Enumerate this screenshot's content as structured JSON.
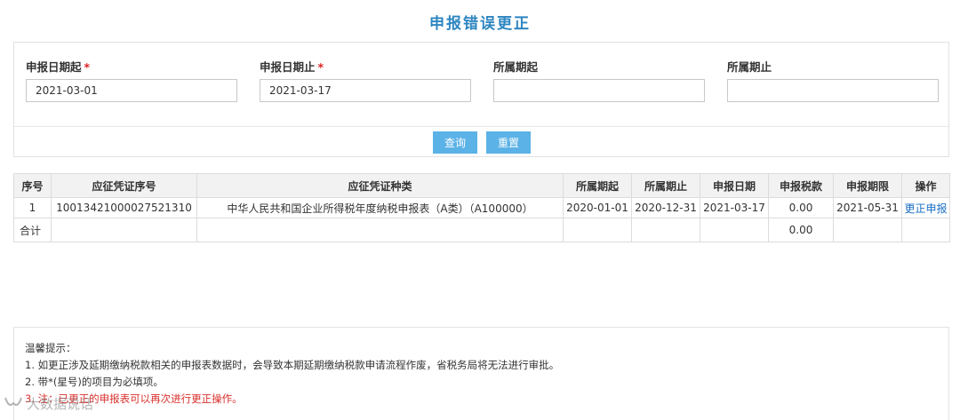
{
  "page": {
    "title": "申报错误更正"
  },
  "filters": {
    "start_date": {
      "label": "申报日期起",
      "required_mark": "*",
      "value": "2021-03-01"
    },
    "end_date": {
      "label": "申报日期止",
      "required_mark": "*",
      "value": "2021-03-17"
    },
    "period_start": {
      "label": "所属期起",
      "value": ""
    },
    "period_end": {
      "label": "所属期止",
      "value": ""
    }
  },
  "buttons": {
    "query": "查询",
    "reset": "重置"
  },
  "table": {
    "headers": [
      "序号",
      "应征凭证序号",
      "应征凭证种类",
      "所属期起",
      "所属期止",
      "申报日期",
      "申报税款",
      "申报期限",
      "操作"
    ],
    "rows": [
      {
        "index": "1",
        "voucher_no": "10013421000027521310",
        "voucher_type": "中华人民共和国企业所得税年度纳税申报表（A类）（A100000）",
        "period_start": "2020-01-01",
        "period_end": "2020-12-31",
        "declare_date": "2021-03-17",
        "tax_amount": "0.00",
        "deadline": "2021-05-31",
        "action": "更正申报"
      }
    ],
    "total": {
      "label": "合计",
      "tax_amount": "0.00"
    }
  },
  "tips": {
    "title": "温馨提示：",
    "items": [
      "1. 如更正涉及延期缴纳税款相关的申报表数据时，会导致本期延期缴纳税款申请流程作废，省税务局将无法进行审批。",
      "2. 带*(星号)的项目为必填项。",
      "3. 注：已更正的申报表可以再次进行更正操作。"
    ]
  },
  "watermark": {
    "icon": "wechat-channel-icon",
    "text": "大数据说话"
  },
  "colors": {
    "accent": "#2e86c1",
    "button": "#5bb2e6",
    "link": "#1a6fc4",
    "warning": "#d9302c"
  }
}
